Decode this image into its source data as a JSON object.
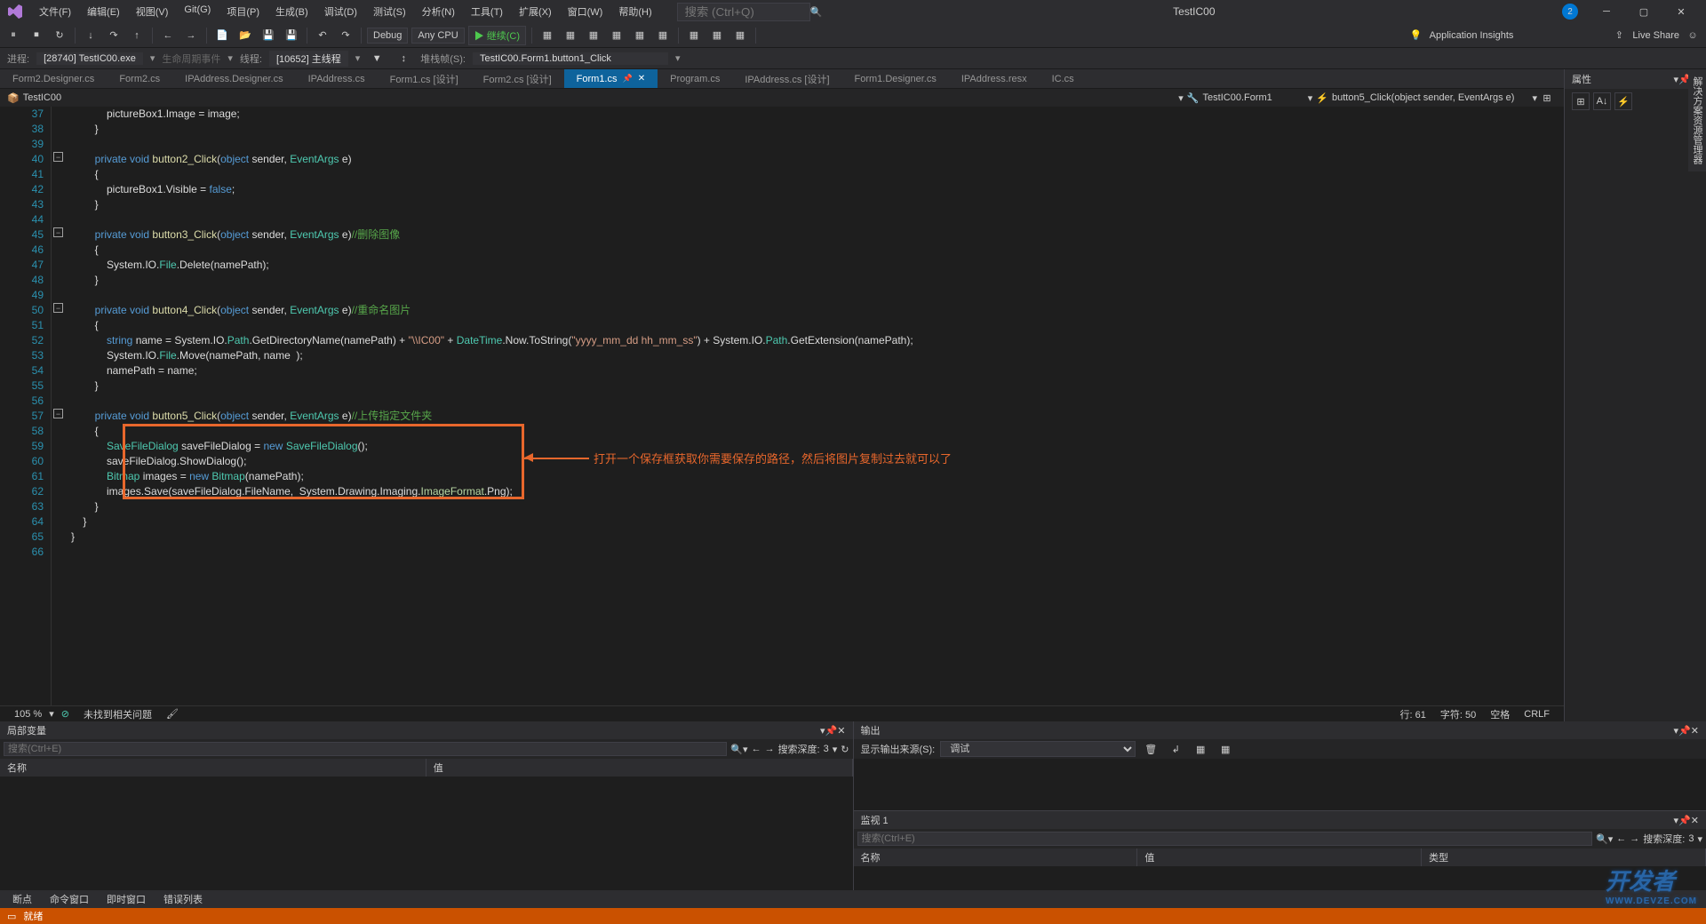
{
  "menus": [
    "文件(F)",
    "编辑(E)",
    "视图(V)",
    "Git(G)",
    "项目(P)",
    "生成(B)",
    "调试(D)",
    "测试(S)",
    "分析(N)",
    "工具(T)",
    "扩展(X)",
    "窗口(W)",
    "帮助(H)"
  ],
  "search_placeholder": "搜索 (Ctrl+Q)",
  "app_title": "TestIC00",
  "badge": "2",
  "toolbar": {
    "config": "Debug",
    "platform": "Any CPU",
    "continue": "▶ 继续(C)",
    "insights": "Application Insights",
    "liveshare": "Live Share"
  },
  "process_bar": {
    "label": "进程:",
    "process": "[28740] TestIC00.exe",
    "lifecycle": "生命周期事件",
    "thread_label": "线程:",
    "thread": "[10652] 主线程",
    "stack_label": "堆栈帧(S):",
    "stack": "TestIC00.Form1.button1_Click"
  },
  "tabs": [
    "Form2.Designer.cs",
    "Form2.cs",
    "IPAddress.Designer.cs",
    "IPAddress.cs",
    "Form1.cs [设计]",
    "Form2.cs [设计]",
    "Form1.cs",
    "Program.cs",
    "IPAddress.cs [设计]",
    "Form1.Designer.cs",
    "IPAddress.resx",
    "IC.cs"
  ],
  "active_tab_index": 6,
  "breadcrumb": {
    "project": "TestIC00",
    "class": "TestIC00.Form1",
    "method": "button5_Click(object sender, EventArgs e)"
  },
  "line_start": 37,
  "line_end": 66,
  "code": {
    "l37": "            pictureBox1.Image = image;",
    "l39": "",
    "l40": "        private void button2_Click(object sender, EventArgs e)",
    "l42": "            pictureBox1.Visible = false;",
    "l45_pre": "        private void button3_Click(object sender, EventArgs e)",
    "l45_cmt": "//删除图像",
    "l47": "            System.IO.File.Delete(namePath);",
    "l50_pre": "        private void button4_Click(object sender, EventArgs e)",
    "l50_cmt": "//重命名图片",
    "l52": "            string name = System.IO.Path.GetDirectoryName(namePath) + \"\\\\IC00\" + DateTime.Now.ToString(\"yyyy_mm_dd hh_mm_ss\") + System.IO.Path.GetExtension(namePath);",
    "l53": "            System.IO.File.Move(namePath, name  );",
    "l54": "            namePath = name;",
    "l57_pre": "        private void button5_Click(object sender, EventArgs e)",
    "l57_cmt": "//上传指定文件夹",
    "l59": "            SaveFileDialog saveFileDialog = new SaveFileDialog();",
    "l60": "            saveFileDialog.ShowDialog();",
    "l61": "            Bitmap images = new Bitmap(namePath);",
    "l62": "            images.Save(saveFileDialog.FileName,  System.Drawing.Imaging.ImageFormat.Png);"
  },
  "annotation": "打开一个保存框获取你需要保存的路径，然后将图片复制过去就可以了",
  "editor_status": {
    "zoom": "105 %",
    "issues": "未找到相关问题",
    "line": "行: 61",
    "char": "字符: 50",
    "spaces": "空格",
    "crlf": "CRLF"
  },
  "properties_panel": "属性",
  "locals_panel": {
    "title": "局部变量",
    "search": "搜索(Ctrl+E)",
    "depth_label": "搜索深度:",
    "depth": "3",
    "cols": [
      "名称",
      "值"
    ]
  },
  "output_panel": {
    "title": "输出",
    "source_label": "显示输出来源(S):",
    "source": "调试"
  },
  "watch_panel": {
    "title": "监视 1",
    "search": "搜索(Ctrl+E)",
    "depth_label": "搜索深度:",
    "depth": "3",
    "cols": [
      "名称",
      "值",
      "类型"
    ]
  },
  "bottom_tabs": [
    "断点",
    "命令窗口",
    "即时窗口",
    "错误列表"
  ],
  "status_bar": "就绪",
  "watermark": "开发者",
  "watermark_sub": "WWW.DEVZE.COM",
  "vert_tab": "解决方案资源管理器"
}
